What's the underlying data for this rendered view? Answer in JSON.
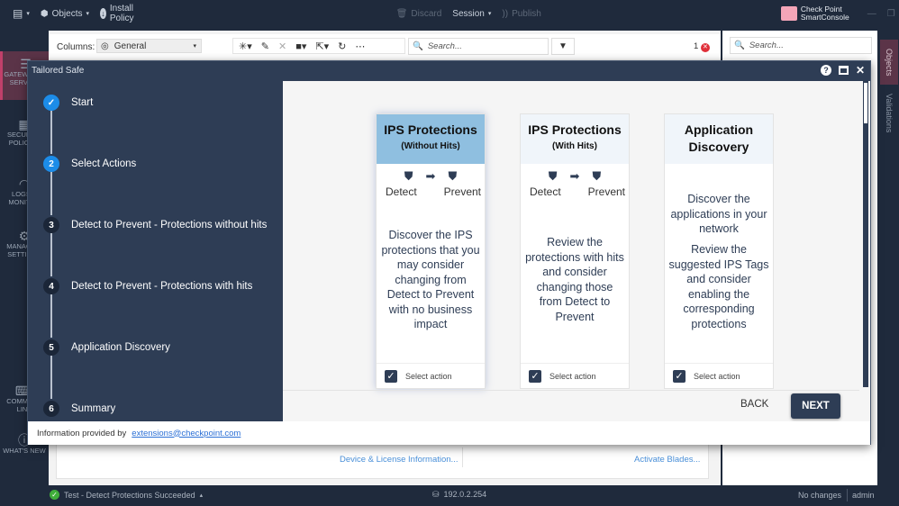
{
  "topbar": {
    "menu_label": "",
    "objects_label": "Objects",
    "install_policy_label": "Install Policy",
    "discard_label": "Discard",
    "session_label": "Session",
    "publish_label": "Publish",
    "brand_line1": "Check Point",
    "brand_line2": "SmartConsole"
  },
  "toolbar": {
    "columns_label": "Columns:",
    "columns_value": "General",
    "search_placeholder": "Search...",
    "error_count": "1",
    "right_search_placeholder": "Search..."
  },
  "leftnav": [
    {
      "label": "GATEWAYS & SERVERS",
      "icon": "server-icon",
      "active": true
    },
    {
      "label": "SECURITY POLICIES",
      "icon": "grid-icon"
    },
    {
      "label": "LOGS & MONITOR",
      "icon": "gauge-icon"
    },
    {
      "label": "MANAGE & SETTINGS",
      "icon": "gear-icon"
    },
    {
      "label": "COMMAND LINE",
      "icon": "terminal-icon"
    },
    {
      "label": "WHAT'S NEW",
      "icon": "question-icon"
    }
  ],
  "right_tabs": [
    "Objects",
    "Validations"
  ],
  "background": {
    "device_license_link": "Device & License Information...",
    "activate_blades_link": "Activate Blades..."
  },
  "dialog": {
    "title": "Tailored Safe",
    "steps": [
      {
        "num": "✓",
        "label": "Start",
        "state": "done"
      },
      {
        "num": "2",
        "label": "Select Actions",
        "state": "current"
      },
      {
        "num": "3",
        "label": "Detect to Prevent - Protections without hits",
        "state": "pending"
      },
      {
        "num": "4",
        "label": "Detect to Prevent - Protections with hits",
        "state": "pending"
      },
      {
        "num": "5",
        "label": "Application Discovery",
        "state": "pending"
      },
      {
        "num": "6",
        "label": "Summary",
        "state": "pending"
      }
    ],
    "cards": [
      {
        "title": "IPS Protections",
        "subtitle": "(Without Hits)",
        "detect": "Detect",
        "prevent": "Prevent",
        "description": "Discover the IPS protections that you may consider changing from Detect to Prevent with no business impact",
        "checkbox_label": "Select action",
        "checked": true
      },
      {
        "title": "IPS Protections",
        "subtitle": "(With Hits)",
        "detect": "Detect",
        "prevent": "Prevent",
        "description": "Review the protections with hits and consider changing those from Detect to Prevent",
        "checkbox_label": "Select action",
        "checked": true
      },
      {
        "title": "Application Discovery",
        "description1": "Discover the applications in your network",
        "description2": "Review the suggested IPS Tags and consider enabling the corresponding protections",
        "checkbox_label": "Select action",
        "checked": true
      }
    ],
    "back_label": "BACK",
    "next_label": "NEXT",
    "footer_text": "Information provided by",
    "footer_link": "extensions@checkpoint.com"
  },
  "statusbar": {
    "task_text": "Test - Detect Protections Succeeded",
    "server_ip": "192.0.2.254",
    "changes": "No changes",
    "user": "admin"
  }
}
